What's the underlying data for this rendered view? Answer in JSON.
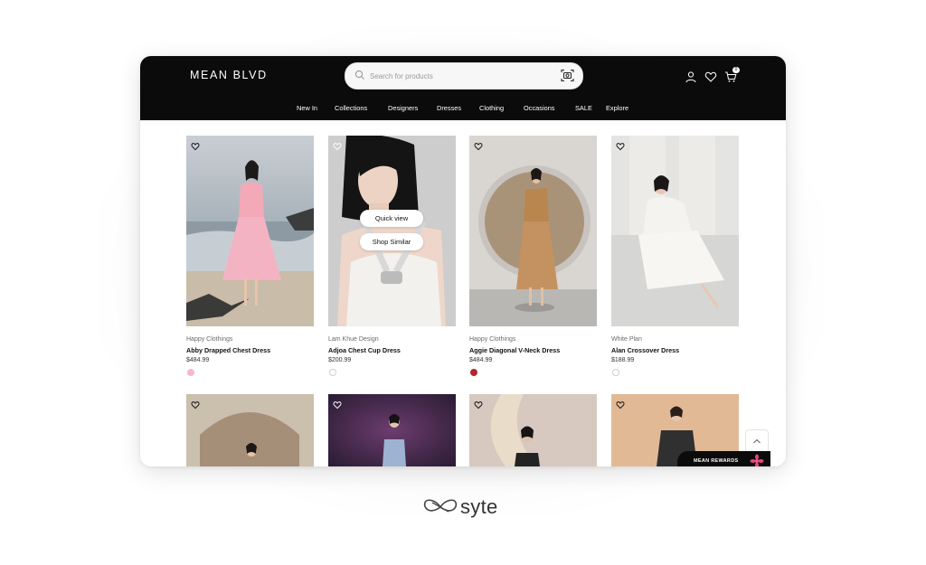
{
  "header": {
    "logo": "MEAN BLVD",
    "search": {
      "placeholder": "Search for products"
    },
    "cart_count": "0"
  },
  "nav": [
    {
      "label": "New In"
    },
    {
      "label": "Collections"
    },
    {
      "label": "Designers"
    },
    {
      "label": "Dresses"
    },
    {
      "label": "Clothing"
    },
    {
      "label": "Occasions"
    },
    {
      "label": "SALE"
    },
    {
      "label": "Explore"
    }
  ],
  "products": [
    {
      "brand": "Happy Clothings",
      "name": "Abby Drapped Chest Dress",
      "price": "$484.99",
      "swatch": "#f7b6c8"
    },
    {
      "brand": "Lam Khue Design",
      "name": "Adjoa Chest Cup Dress",
      "price": "$200.99",
      "swatch": "#ffffff"
    },
    {
      "brand": "Happy Clothings",
      "name": "Aggie Diagonal V-Neck Dress",
      "price": "$484.99",
      "swatch": "#b3272d"
    },
    {
      "brand": "White Plan",
      "name": "Alan Crossover Dress",
      "price": "$188.99",
      "swatch": "#ffffff"
    }
  ],
  "hover": {
    "quick_view": "Quick view",
    "shop_similar": "Shop Similar"
  },
  "rewards": {
    "label": "MEAN REWARDS"
  },
  "footer": {
    "brand": "syte"
  }
}
